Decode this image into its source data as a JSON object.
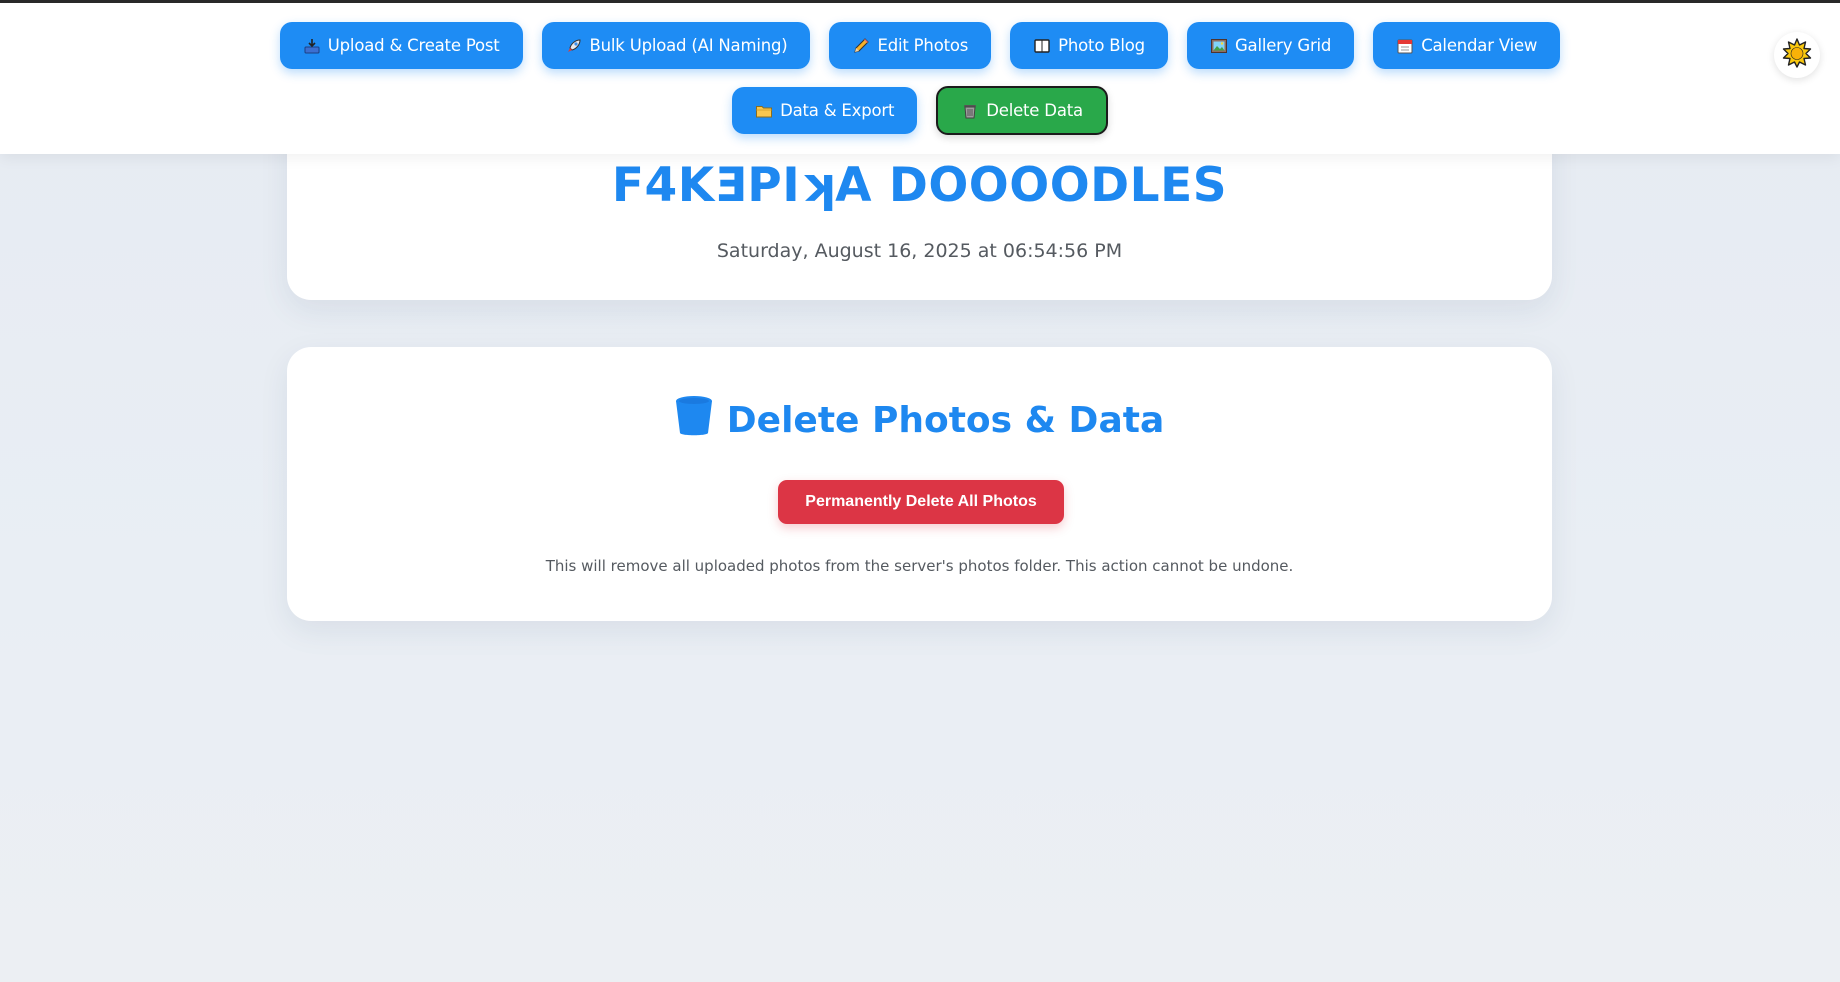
{
  "nav": {
    "row1": [
      {
        "label": "Upload & Create Post",
        "icon": "inbox-tray-icon"
      },
      {
        "label": "Bulk Upload (AI Naming)",
        "icon": "rocket-icon"
      },
      {
        "label": "Edit Photos",
        "icon": "pencil-icon"
      },
      {
        "label": "Photo Blog",
        "icon": "book-icon"
      },
      {
        "label": "Gallery Grid",
        "icon": "framed-picture-icon"
      },
      {
        "label": "Calendar View",
        "icon": "calendar-icon"
      }
    ],
    "row2": [
      {
        "label": "Data & Export",
        "icon": "folder-icon"
      },
      {
        "label": "Delete Data",
        "icon": "wastebasket-icon",
        "active": true
      }
    ],
    "theme_toggle_icon": "sun-icon"
  },
  "header": {
    "title": "F4KƎPIʞA DOOOODLES",
    "datetime": "Saturday, August 16, 2025 at 06:54:56 PM"
  },
  "delete_section": {
    "icon": "bucket-icon",
    "title": "Delete Photos & Data",
    "button_label": "Permanently Delete All Photos",
    "warning": "This will remove all uploaded photos from the server's photos folder. This action cannot be undone."
  },
  "colors": {
    "primary": "#1e8cf4",
    "active": "#29a84a",
    "danger": "#dc3545",
    "title": "#1e88f0"
  }
}
